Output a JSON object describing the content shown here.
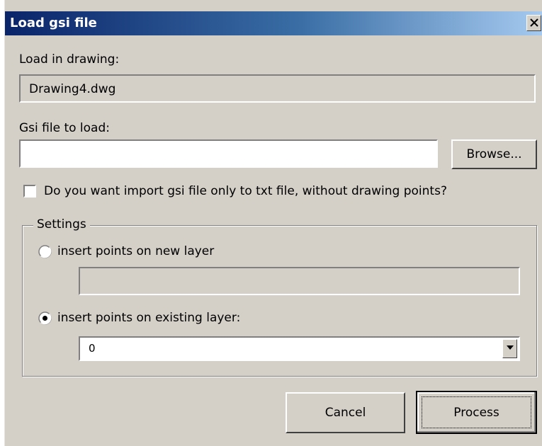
{
  "window": {
    "title": "Load gsi file"
  },
  "drawing": {
    "label": "Load in drawing:",
    "value": "Drawing4.dwg"
  },
  "gsi_file": {
    "label": "Gsi file to load:",
    "value": "",
    "browse_label": "Browse..."
  },
  "txt_only": {
    "label": "Do you want import gsi file only to txt file, without drawing points?",
    "checked": false
  },
  "settings": {
    "legend": "Settings",
    "new_layer_label": "insert points on new layer",
    "new_layer_value": "",
    "existing_layer_label": "insert points on existing layer:",
    "existing_layer_selected": "0",
    "selected_option": "existing_layer"
  },
  "buttons": {
    "cancel": "Cancel",
    "process": "Process"
  },
  "icons": {
    "close": "close-icon",
    "dropdown": "chevron-down-icon"
  }
}
